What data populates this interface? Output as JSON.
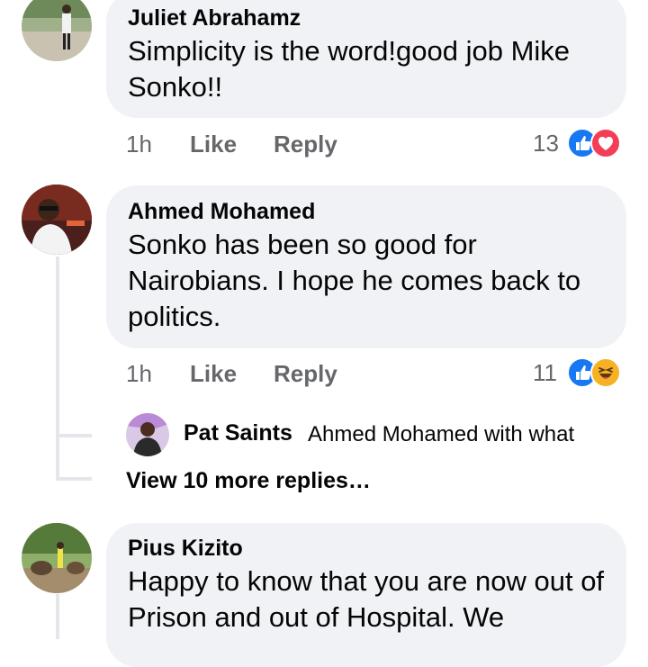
{
  "comments": [
    {
      "author": "Juliet Abrahamz",
      "text": "Simplicity is the word!good job Mike Sonko!!",
      "time": "1h",
      "like_label": "Like",
      "reply_label": "Reply",
      "reaction_count": "13",
      "reactions": [
        "like-icon",
        "love-icon"
      ]
    },
    {
      "author": "Ahmed Mohamed",
      "text": "Sonko has been so good for Nairobians. I hope he comes back to politics.",
      "time": "1h",
      "like_label": "Like",
      "reply_label": "Reply",
      "reaction_count": "11",
      "reactions": [
        "like-icon",
        "haha-icon"
      ],
      "reply": {
        "author": "Pat Saints",
        "text": "Ahmed Mohamed with what"
      },
      "view_more_label": "View 10 more replies…"
    },
    {
      "author": "Pius Kizito",
      "text": "Happy to know that you are now  out of Prison and out of Hospital. We"
    }
  ],
  "colors": {
    "bubble": "#f0f2f5",
    "like_blue": "#1877f2",
    "love_red": "#f33e58",
    "haha_yellow": "#f7b125",
    "secondary_text": "#65676b"
  }
}
